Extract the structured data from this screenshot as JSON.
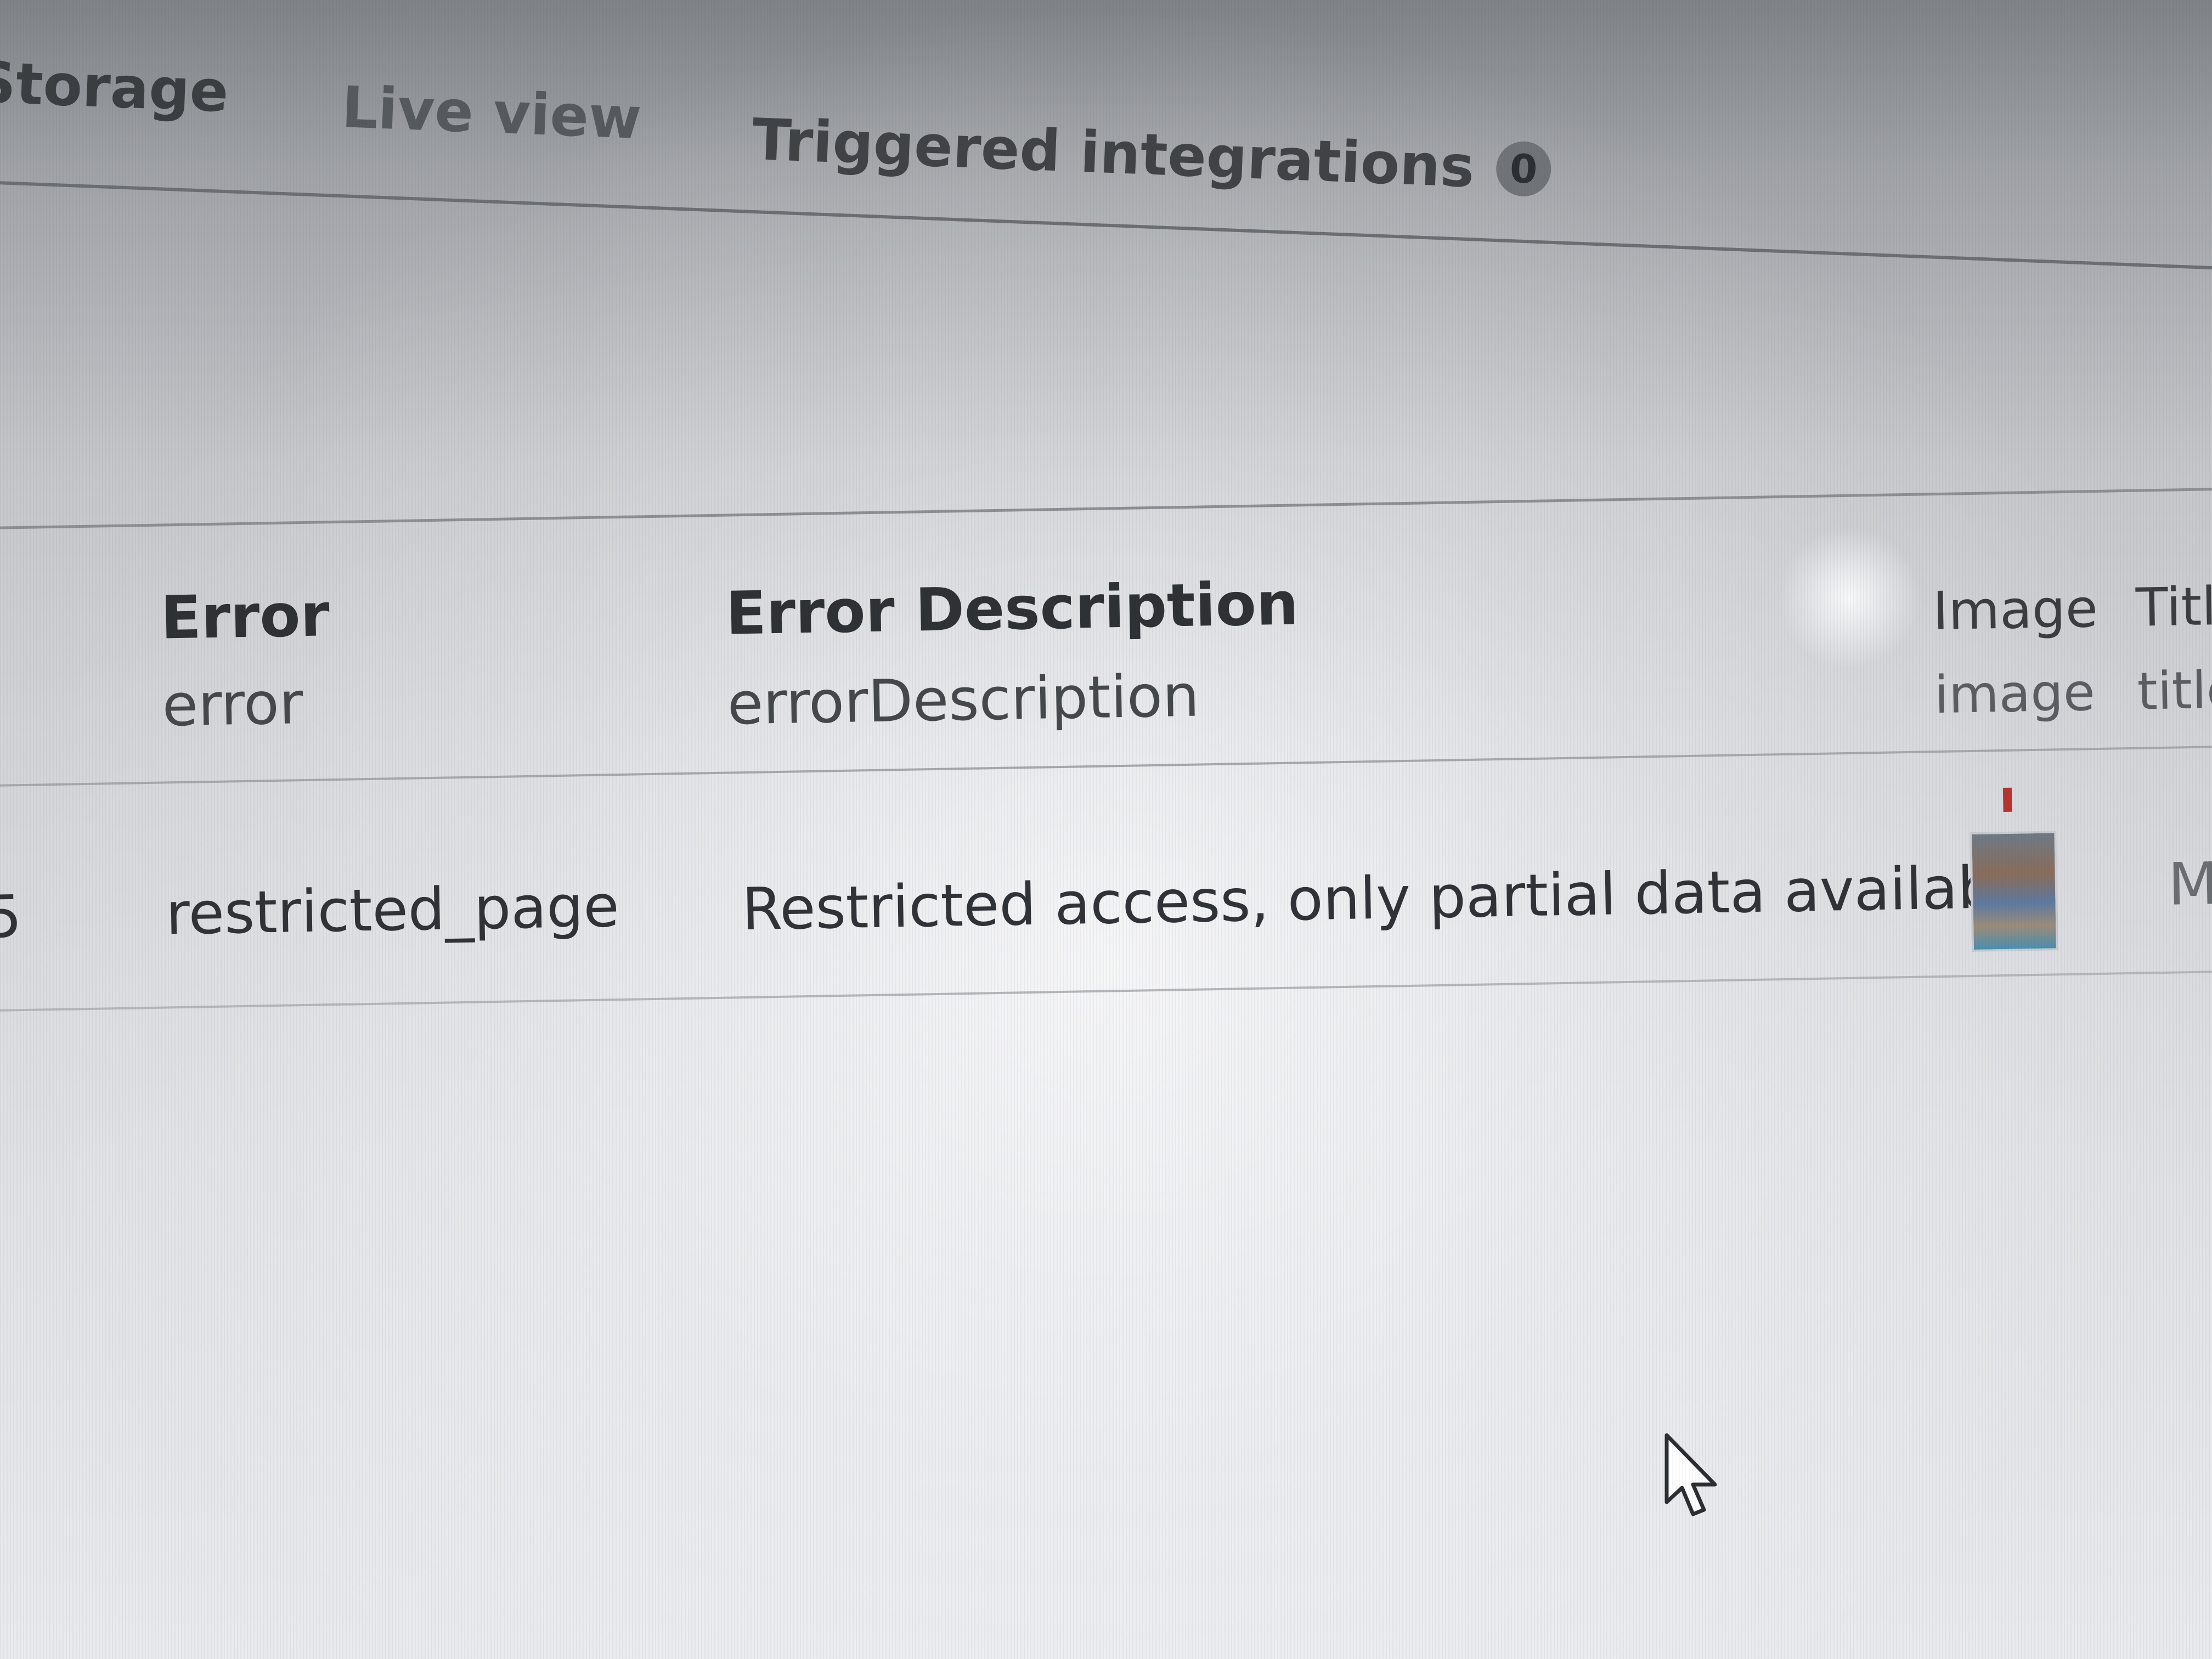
{
  "tabs": {
    "storage_label": "Storage",
    "live_view_label": "Live view",
    "triggered_label": "Triggered integrations",
    "triggered_count": "0"
  },
  "table": {
    "columns": [
      {
        "title": "Error",
        "key": "error"
      },
      {
        "title": "Error Description",
        "key": "errorDescription"
      },
      {
        "title": "Image",
        "key": "image"
      },
      {
        "title": "Title",
        "key": "title"
      }
    ],
    "rows": [
      {
        "index_fragment": "5",
        "error": "restricted_page",
        "error_description": "Restricted access, only partial data available",
        "title_fragment": "M"
      }
    ]
  },
  "cursor": {
    "icon": "arrow-cursor-icon"
  }
}
